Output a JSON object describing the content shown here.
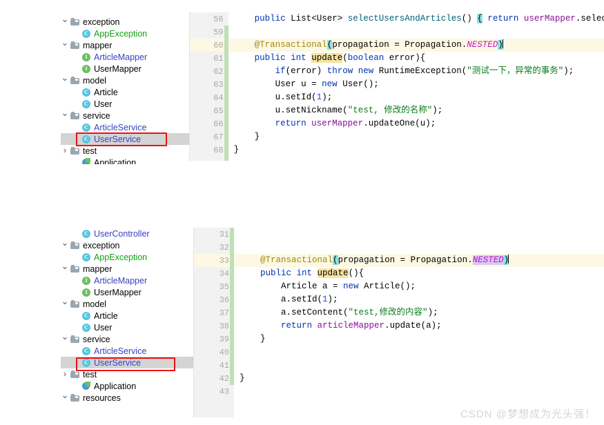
{
  "app": {
    "watermark": "CSDN @梦想成为光头强！"
  },
  "top_panel": {
    "tree": {
      "items": [
        {
          "arrow": "down",
          "icon": "folder-icon",
          "label": "exception",
          "indent": 1,
          "color": "plain",
          "selected": false
        },
        {
          "arrow": "blank",
          "icon": "class-icon",
          "label": "AppException",
          "indent": 2,
          "color": "green",
          "selected": false
        },
        {
          "arrow": "down",
          "icon": "folder-icon",
          "label": "mapper",
          "indent": 1,
          "color": "plain",
          "selected": false
        },
        {
          "arrow": "blank",
          "icon": "interface-icon",
          "label": "ArticleMapper",
          "indent": 2,
          "color": "blue",
          "selected": false
        },
        {
          "arrow": "blank",
          "icon": "interface-icon",
          "label": "UserMapper",
          "indent": 2,
          "color": "plain",
          "selected": false
        },
        {
          "arrow": "down",
          "icon": "folder-icon",
          "label": "model",
          "indent": 1,
          "color": "plain",
          "selected": false
        },
        {
          "arrow": "blank",
          "icon": "class-icon",
          "label": "Article",
          "indent": 2,
          "color": "plain",
          "selected": false
        },
        {
          "arrow": "blank",
          "icon": "class-icon",
          "label": "User",
          "indent": 2,
          "color": "plain",
          "selected": false
        },
        {
          "arrow": "down",
          "icon": "folder-icon",
          "label": "service",
          "indent": 1,
          "color": "plain",
          "selected": false
        },
        {
          "arrow": "blank",
          "icon": "class-icon",
          "label": "ArticleService",
          "indent": 2,
          "color": "blue",
          "selected": false
        },
        {
          "arrow": "blank",
          "icon": "class-icon",
          "label": "UserService",
          "indent": 2,
          "color": "blue",
          "selected": true
        },
        {
          "arrow": "right",
          "icon": "folder-icon",
          "label": "test",
          "indent": 1,
          "color": "plain",
          "selected": false
        },
        {
          "arrow": "blank",
          "icon": "app-icon",
          "label": "Application",
          "indent": 2,
          "color": "plain",
          "selected": false
        }
      ],
      "annotated_label": "UserService"
    },
    "gutter": {
      "line_numbers": [
        "56",
        "59",
        "60",
        "61",
        "62",
        "63",
        "64",
        "65",
        "66",
        "67",
        "68"
      ],
      "caret_line": "60"
    },
    "code_lines": [
      {
        "tokens": [
          {
            "t": "    ",
            "c": "ident"
          },
          {
            "t": "public ",
            "c": "kw"
          },
          {
            "t": "List",
            "c": "typ"
          },
          {
            "t": "<",
            "c": "ident"
          },
          {
            "t": "User",
            "c": "typ"
          },
          {
            "t": "> ",
            "c": "ident"
          },
          {
            "t": "selectUsersAndArticles",
            "c": "mtd"
          },
          {
            "t": "() ",
            "c": "ident"
          },
          {
            "t": "{",
            "c": "hl-cyan"
          },
          {
            "t": " ",
            "c": "ident"
          },
          {
            "t": "return ",
            "c": "kw"
          },
          {
            "t": "userMapper",
            "c": "fld"
          },
          {
            "t": ".selectU",
            "c": "ident"
          }
        ],
        "caret": false
      },
      {
        "tokens": [],
        "caret": false
      },
      {
        "tokens": [
          {
            "t": "    ",
            "c": "ident"
          },
          {
            "t": "@Transactional",
            "c": "ann"
          },
          {
            "t": "(",
            "c": "hl-cyan"
          },
          {
            "t": "propagation = Propagation.",
            "c": "ident"
          },
          {
            "t": "NESTED",
            "c": "cst"
          },
          {
            "t": ")",
            "c": "hl-cyan"
          }
        ],
        "caret": true
      },
      {
        "tokens": [
          {
            "t": "    ",
            "c": "ident"
          },
          {
            "t": "public ",
            "c": "kw"
          },
          {
            "t": "int ",
            "c": "kw"
          },
          {
            "t": "update",
            "c": "hl-tan"
          },
          {
            "t": "(",
            "c": "ident"
          },
          {
            "t": "boolean ",
            "c": "kw"
          },
          {
            "t": "error",
            "c": "ident"
          },
          {
            "t": "){",
            "c": "ident"
          }
        ],
        "caret": false
      },
      {
        "tokens": [
          {
            "t": "        ",
            "c": "ident"
          },
          {
            "t": "if",
            "c": "kw"
          },
          {
            "t": "(error) ",
            "c": "ident"
          },
          {
            "t": "throw ",
            "c": "kw"
          },
          {
            "t": "new ",
            "c": "kw"
          },
          {
            "t": "RuntimeException(",
            "c": "ident"
          },
          {
            "t": "\"测试一下，异常的事务\"",
            "c": "str"
          },
          {
            "t": ");",
            "c": "ident"
          }
        ],
        "caret": false
      },
      {
        "tokens": [
          {
            "t": "        ",
            "c": "ident"
          },
          {
            "t": "User u = ",
            "c": "ident"
          },
          {
            "t": "new ",
            "c": "kw"
          },
          {
            "t": "User();",
            "c": "ident"
          }
        ],
        "caret": false
      },
      {
        "tokens": [
          {
            "t": "        ",
            "c": "ident"
          },
          {
            "t": "u.setId(",
            "c": "ident"
          },
          {
            "t": "1",
            "c": "num"
          },
          {
            "t": ");",
            "c": "ident"
          }
        ],
        "caret": false
      },
      {
        "tokens": [
          {
            "t": "        ",
            "c": "ident"
          },
          {
            "t": "u.setNickname(",
            "c": "ident"
          },
          {
            "t": "\"test, 修改的名称\"",
            "c": "str"
          },
          {
            "t": ");",
            "c": "ident"
          }
        ],
        "caret": false
      },
      {
        "tokens": [
          {
            "t": "        ",
            "c": "ident"
          },
          {
            "t": "return ",
            "c": "kw"
          },
          {
            "t": "userMapper",
            "c": "fld"
          },
          {
            "t": ".updateOne(u);",
            "c": "ident"
          }
        ],
        "caret": false
      },
      {
        "tokens": [
          {
            "t": "    }",
            "c": "ident"
          }
        ],
        "caret": false
      },
      {
        "tokens": [
          {
            "t": "}",
            "c": "ident"
          }
        ],
        "caret": false
      }
    ]
  },
  "bottom_panel": {
    "tree": {
      "items": [
        {
          "arrow": "blank",
          "icon": "class-icon",
          "label": "UserController",
          "indent": 2,
          "color": "blue",
          "selected": false
        },
        {
          "arrow": "down",
          "icon": "folder-icon",
          "label": "exception",
          "indent": 1,
          "color": "plain",
          "selected": false
        },
        {
          "arrow": "blank",
          "icon": "class-icon",
          "label": "AppException",
          "indent": 2,
          "color": "green",
          "selected": false
        },
        {
          "arrow": "down",
          "icon": "folder-icon",
          "label": "mapper",
          "indent": 1,
          "color": "plain",
          "selected": false
        },
        {
          "arrow": "blank",
          "icon": "interface-icon",
          "label": "ArticleMapper",
          "indent": 2,
          "color": "blue",
          "selected": false
        },
        {
          "arrow": "blank",
          "icon": "interface-icon",
          "label": "UserMapper",
          "indent": 2,
          "color": "plain",
          "selected": false
        },
        {
          "arrow": "down",
          "icon": "folder-icon",
          "label": "model",
          "indent": 1,
          "color": "plain",
          "selected": false
        },
        {
          "arrow": "blank",
          "icon": "class-icon",
          "label": "Article",
          "indent": 2,
          "color": "plain",
          "selected": false
        },
        {
          "arrow": "blank",
          "icon": "class-icon",
          "label": "User",
          "indent": 2,
          "color": "plain",
          "selected": false
        },
        {
          "arrow": "down",
          "icon": "folder-icon",
          "label": "service",
          "indent": 1,
          "color": "plain",
          "selected": false
        },
        {
          "arrow": "blank",
          "icon": "class-icon",
          "label": "ArticleService",
          "indent": 2,
          "color": "blue",
          "selected": false
        },
        {
          "arrow": "blank",
          "icon": "class-icon",
          "label": "UserService",
          "indent": 2,
          "color": "blue",
          "selected": true
        },
        {
          "arrow": "right",
          "icon": "folder-icon",
          "label": "test",
          "indent": 1,
          "color": "plain",
          "selected": false
        },
        {
          "arrow": "blank",
          "icon": "app-icon",
          "label": "Application",
          "indent": 2,
          "color": "plain",
          "selected": false
        },
        {
          "arrow": "down",
          "icon": "folder-icon",
          "label": "resources",
          "indent": 1,
          "color": "plain",
          "selected": false
        }
      ],
      "annotated_label": "UserService"
    },
    "gutter": {
      "line_numbers": [
        "31",
        "32",
        "33",
        "34",
        "35",
        "36",
        "37",
        "38",
        "39",
        "40",
        "41",
        "42",
        "43"
      ],
      "caret_line": "33"
    },
    "code_lines": [
      {
        "tokens": [],
        "caret": false
      },
      {
        "tokens": [],
        "caret": false
      },
      {
        "tokens": [
          {
            "t": "    ",
            "c": "ident"
          },
          {
            "t": "@Transactional",
            "c": "ann"
          },
          {
            "t": "(",
            "c": "hl-cyan"
          },
          {
            "t": "propagation = Propagation.",
            "c": "ident"
          },
          {
            "t": "NESTED",
            "c": "cst-sel"
          },
          {
            "t": ")",
            "c": "hl-cyan"
          }
        ],
        "caret": true
      },
      {
        "tokens": [
          {
            "t": "    ",
            "c": "ident"
          },
          {
            "t": "public ",
            "c": "kw"
          },
          {
            "t": "int ",
            "c": "kw"
          },
          {
            "t": "update",
            "c": "hl-tan"
          },
          {
            "t": "(){",
            "c": "ident"
          }
        ],
        "caret": false
      },
      {
        "tokens": [
          {
            "t": "        ",
            "c": "ident"
          },
          {
            "t": "Article a = ",
            "c": "ident"
          },
          {
            "t": "new ",
            "c": "kw"
          },
          {
            "t": "Article();",
            "c": "ident"
          }
        ],
        "caret": false
      },
      {
        "tokens": [
          {
            "t": "        ",
            "c": "ident"
          },
          {
            "t": "a.setId(",
            "c": "ident"
          },
          {
            "t": "1",
            "c": "num"
          },
          {
            "t": ");",
            "c": "ident"
          }
        ],
        "caret": false
      },
      {
        "tokens": [
          {
            "t": "        ",
            "c": "ident"
          },
          {
            "t": "a.setContent(",
            "c": "ident"
          },
          {
            "t": "\"test,修改的内容\"",
            "c": "str"
          },
          {
            "t": ");",
            "c": "ident"
          }
        ],
        "caret": false
      },
      {
        "tokens": [
          {
            "t": "        ",
            "c": "ident"
          },
          {
            "t": "return ",
            "c": "kw"
          },
          {
            "t": "articleMapper",
            "c": "fld"
          },
          {
            "t": ".update(a);",
            "c": "ident"
          }
        ],
        "caret": false
      },
      {
        "tokens": [
          {
            "t": "    }",
            "c": "ident"
          }
        ],
        "caret": false
      },
      {
        "tokens": [],
        "caret": false
      },
      {
        "tokens": [],
        "caret": false
      },
      {
        "tokens": [
          {
            "t": "}",
            "c": "ident"
          }
        ],
        "caret": false
      },
      {
        "tokens": [],
        "caret": false
      }
    ]
  }
}
